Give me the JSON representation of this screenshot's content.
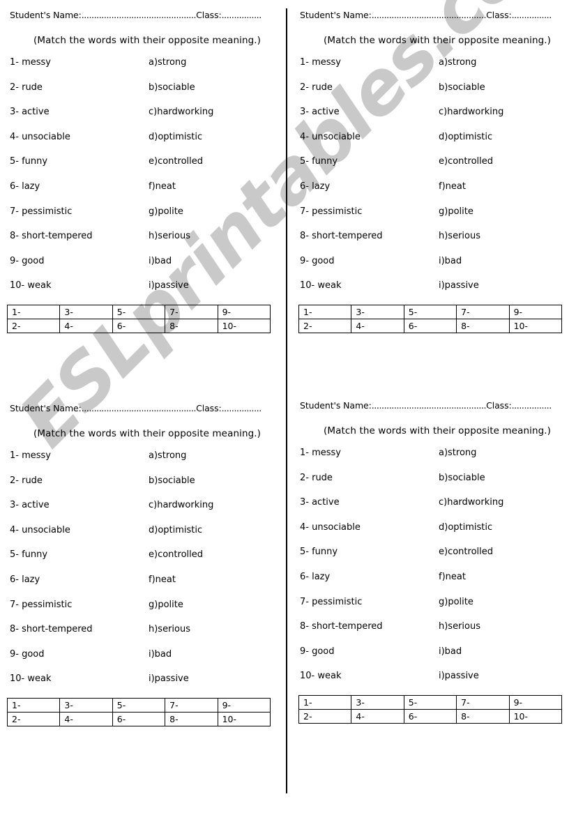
{
  "document": {
    "type": "esl-matching-worksheet",
    "quadrant_count": 4,
    "watermark": "ESLprintables.com",
    "watermark_color": "#c9c9c9"
  },
  "header": {
    "name_label": "Student's Name:",
    "name_dots": "..............................................",
    "class_label": "Class:",
    "class_dots": "................",
    "instruction": "(Match the words with their opposite meaning.)"
  },
  "match": {
    "words": [
      "1- messy",
      "2- rude",
      "3- active",
      "4- unsociable",
      "5- funny",
      "6- lazy",
      "7- pessimistic",
      "8- short-tempered",
      "9- good",
      "10-  weak"
    ],
    "options": [
      "a)strong",
      "b)sociable",
      "c)hardworking",
      "d)optimistic",
      "e)controlled",
      "f)neat",
      "g)polite",
      "h)serious",
      "i)bad",
      "i)passive"
    ]
  },
  "answer_table": {
    "rows": [
      [
        "1-",
        "3-",
        "5-",
        "7-",
        "9-"
      ],
      [
        "2-",
        "4-",
        "6-",
        "8-",
        "10-"
      ]
    ]
  }
}
